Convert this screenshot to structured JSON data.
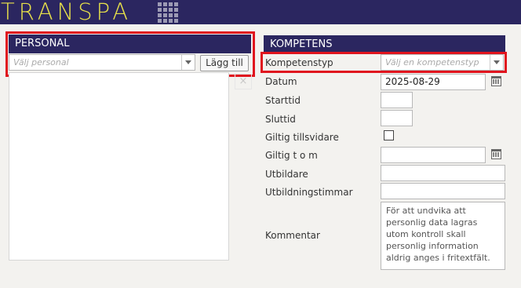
{
  "app": {
    "logo_text": "TRANSPA"
  },
  "personal": {
    "title": "PERSONAL",
    "select_placeholder": "Välj personal",
    "add_button": "Lägg till",
    "remove_icon": "×"
  },
  "kompetens": {
    "title": "KOMPETENS",
    "fields": {
      "kompetenstyp_label": "Kompetenstyp",
      "kompetenstyp_placeholder": "Välj en kompetenstyp",
      "datum_label": "Datum",
      "datum_value": "2025-08-29",
      "starttid_label": "Starttid",
      "sluttid_label": "Sluttid",
      "giltig_tillsvidare_label": "Giltig tillsvidare",
      "giltig_tom_label": "Giltig t o m",
      "utbildare_label": "Utbildare",
      "utbildningstimmar_label": "Utbildningstimmar",
      "kommentar_label": "Kommentar",
      "kommentar_placeholder": "För att undvika att personlig data lagras utom kontroll skall personlig information aldrig anges i fritextfält."
    }
  },
  "icons": {
    "apps": "grid-menu-icon",
    "calendar": "calendar-icon",
    "dropdown": "chevron-down-icon",
    "remove": "close-icon"
  },
  "colors": {
    "header_bg": "#2b2660",
    "logo": "#e7e04a",
    "highlight": "#e0141e"
  }
}
